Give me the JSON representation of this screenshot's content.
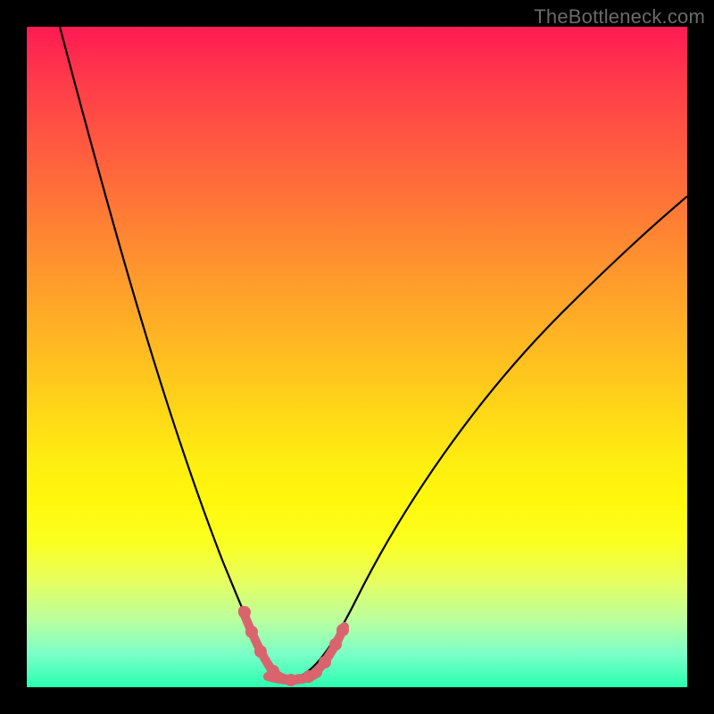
{
  "watermark": "TheBottleneck.com",
  "chart_data": {
    "type": "line",
    "title": "",
    "xlabel": "",
    "ylabel": "",
    "xlim": [
      0,
      100
    ],
    "ylim": [
      0,
      100
    ],
    "x": [
      5,
      10,
      15,
      20,
      22,
      24,
      26,
      28,
      30,
      32,
      34,
      35,
      36,
      37,
      38,
      39,
      40,
      42,
      45,
      48,
      52,
      56,
      60,
      65,
      70,
      75,
      80,
      85,
      90,
      95,
      100
    ],
    "values": [
      100,
      84,
      68,
      52,
      46,
      40,
      34,
      28,
      22,
      16,
      10,
      7,
      5,
      3,
      2,
      1.2,
      1,
      1.2,
      2.5,
      5,
      10,
      16,
      23,
      32,
      41,
      50,
      58,
      65,
      71,
      76,
      80
    ],
    "curve_color": "#000000",
    "highlight_color": "#d9646e",
    "highlight_region_x": [
      33,
      48
    ],
    "highlight_dots": [
      {
        "x": 33.5,
        "y": 10
      },
      {
        "x": 34.5,
        "y": 7
      },
      {
        "x": 36,
        "y": 4
      },
      {
        "x": 38,
        "y": 2
      },
      {
        "x": 40,
        "y": 1.2
      },
      {
        "x": 42,
        "y": 1.2
      },
      {
        "x": 44,
        "y": 2
      },
      {
        "x": 45.5,
        "y": 3.2
      },
      {
        "x": 46.8,
        "y": 5
      },
      {
        "x": 47.8,
        "y": 6.5
      }
    ]
  }
}
